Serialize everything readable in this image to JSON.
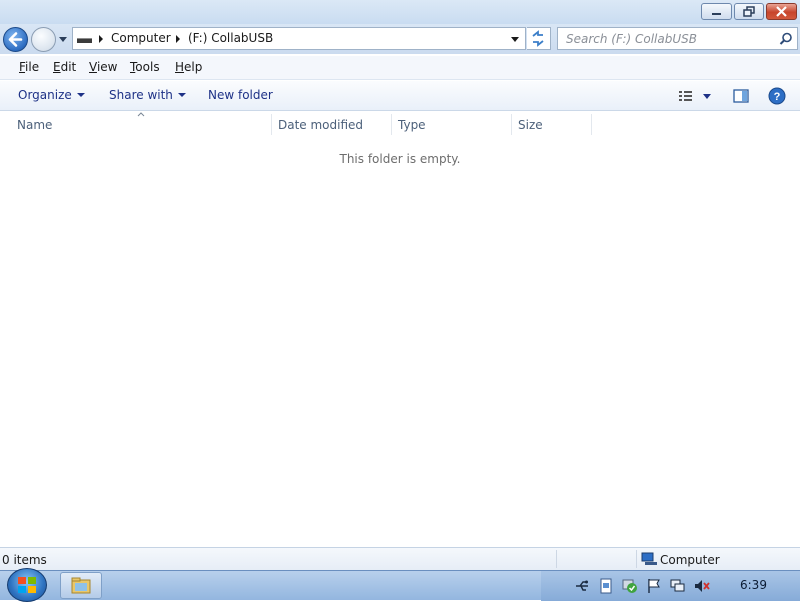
{
  "window": {
    "controls": {
      "minimize_icon": "minimize-icon",
      "maximize_icon": "restore-icon",
      "close_icon": "close-icon"
    }
  },
  "navigation": {
    "breadcrumb": [
      "Computer",
      "(F:) CollabUSB"
    ],
    "search_placeholder": "Search (F:) CollabUSB"
  },
  "menu": [
    {
      "label": "File"
    },
    {
      "label": "Edit"
    },
    {
      "label": "View"
    },
    {
      "label": "Tools"
    },
    {
      "label": "Help"
    }
  ],
  "commands": {
    "organize": "Organize",
    "share_with": "Share with",
    "new_folder": "New folder"
  },
  "columns": [
    "Name",
    "Date modified",
    "Type",
    "Size"
  ],
  "content": {
    "empty_message": "This folder is empty."
  },
  "status": {
    "item_count": "0 items",
    "location": "Computer"
  },
  "taskbar": {
    "clock": "6:39"
  },
  "colors": {
    "accent": "#1e3287",
    "chrome": "#cbdbef",
    "close": "#c7452c"
  }
}
